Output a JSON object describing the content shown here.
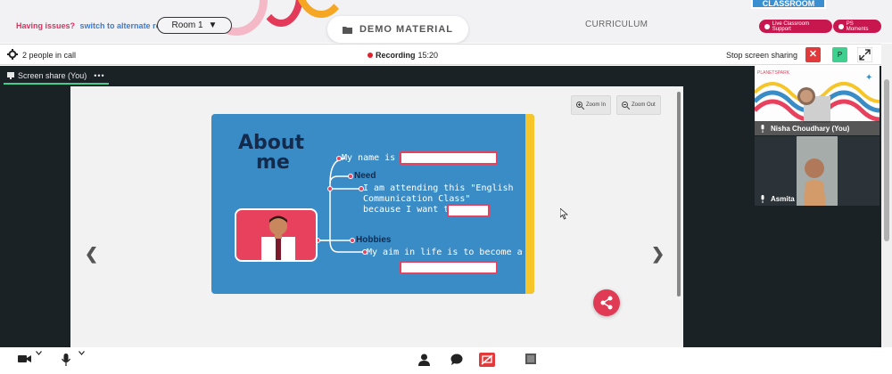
{
  "topbar": {
    "issues_label": "Having issues?",
    "alternate_link": "switch to alternate room",
    "room_select": "Room 1",
    "demo_material": "DEMO MATERIAL",
    "curriculum": "CURRICULUM",
    "classroom_tag": "CLASSROOM",
    "live_support": "Live Classroom Support",
    "ps_moments": "PS Moments"
  },
  "callbar": {
    "people": "2 people in call",
    "recording_label": "Recording",
    "recording_time": "15:20",
    "stop_share": "Stop screen sharing",
    "close_symbol": "✕",
    "participant_initial": "P"
  },
  "share": {
    "tab_label": "Screen share (You)",
    "tab_menu": "•••",
    "zoom_in": "Zoom In",
    "zoom_out": "Zoom Out"
  },
  "slide": {
    "title_line1": "About",
    "title_line2": "me",
    "my_name": "My name is",
    "need": "Need",
    "attending_1": "I am attending this \"English",
    "attending_2": "Communication Class\"",
    "attending_3": "because I want to",
    "hobbies": "Hobbies",
    "aim": "My aim in life is to become a"
  },
  "participants": [
    {
      "name": "Nisha Choudhary (You)"
    },
    {
      "name": "Asmita"
    }
  ],
  "colors": {
    "accent_red": "#c8164f",
    "slide_blue": "#3a8cc7",
    "share_green": "#3fcf8e"
  }
}
